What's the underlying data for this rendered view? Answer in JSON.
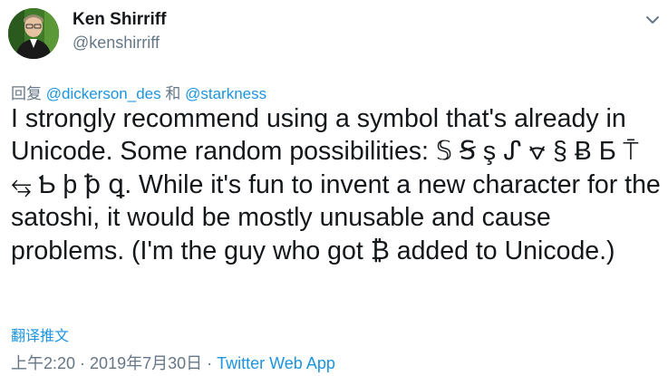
{
  "author": {
    "display_name": "Ken Shirriff",
    "handle": "@kenshirriff"
  },
  "reply": {
    "prefix": "回复",
    "mention_1": "@dickerson_des",
    "joiner": "和",
    "mention_2": "@starkness"
  },
  "tweet": {
    "text": "I strongly recommend using a symbol that's already in Unicode. Some random possibilities: 𝕊 Ꞩ ş ᔑ ⦡ § Ƀ Ƃ ⍑ ⥃ Ƅ þ ꝥ ꝗ. While it's fun to invent a new character for the satoshi, it would be mostly unusable and cause problems. (I'm the guy who got ₿ added to Unicode.)"
  },
  "actions": {
    "translate_label": "翻译推文"
  },
  "meta": {
    "time": "上午2:20",
    "separator_1": " · ",
    "date": "2019年7月30日",
    "separator_2": " · ",
    "source": "Twitter Web App"
  },
  "icons": {
    "avatar": "profile-photo",
    "caret": "chevron-down-icon"
  },
  "colors": {
    "link": "#1b95e0",
    "secondary_text": "#657786",
    "primary_text": "#14171a"
  }
}
